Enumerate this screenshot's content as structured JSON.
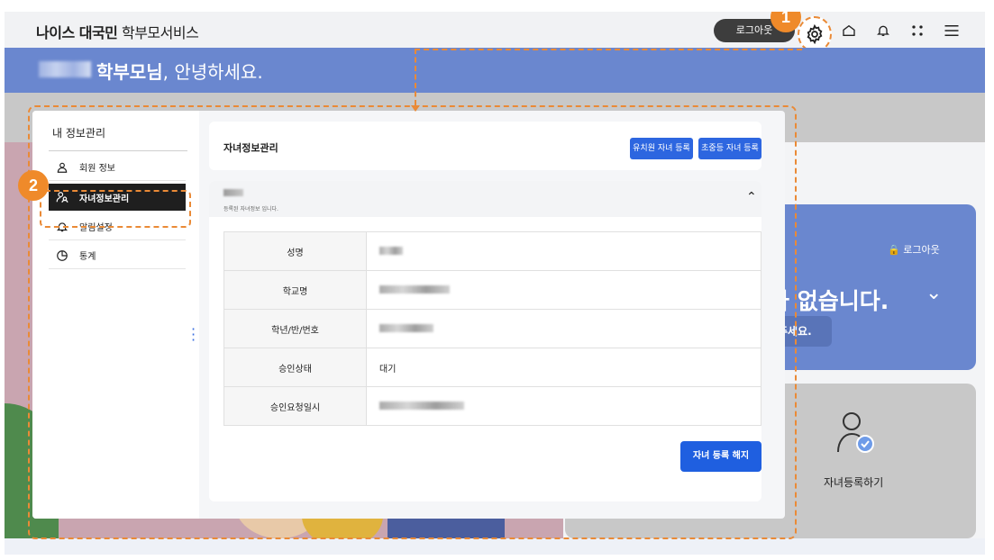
{
  "header": {
    "brand_bold": "나이스 대국민",
    "brand_rest": " 학부모서비스",
    "logout": "로그아웃",
    "icons": [
      "gear-icon",
      "home-icon",
      "bell-icon",
      "apps-icon",
      "menu-icon"
    ]
  },
  "banner": {
    "greeting_bold": "학부모님",
    "greeting_rest": ", 안녕하세요."
  },
  "background_cards": {
    "lock_label": "로그아웃",
    "big_text": "가 없습니다.",
    "button_text": "주세요.",
    "register_label": "자녀등록하기"
  },
  "sidebar": {
    "title": "내 정보관리",
    "items": [
      {
        "label": "회원 정보",
        "icon": "user-icon"
      },
      {
        "label": "자녀정보관리",
        "icon": "children-icon"
      },
      {
        "label": "알림설정",
        "icon": "bell-icon"
      },
      {
        "label": "통계",
        "icon": "pie-chart-icon"
      }
    ]
  },
  "content": {
    "title": "자녀정보관리",
    "btn_kinder": "유치원 자녀 등록",
    "btn_school": "초중등 자녀 등록",
    "child_note": "등록된 자녀정보 입니다.",
    "rows": [
      {
        "label": "성명",
        "value": ""
      },
      {
        "label": "학교명",
        "value": ""
      },
      {
        "label": "학년/반/번호",
        "value": ""
      },
      {
        "label": "승인상태",
        "value": "대기"
      },
      {
        "label": "승인요청일시",
        "value": ""
      }
    ],
    "unregister": "자녀 등록 해지"
  },
  "callouts": {
    "one": "1",
    "two": "2"
  },
  "colors": {
    "accent": "#ea8a36",
    "primary": "#2d66e0",
    "banner": "#6a87cf"
  }
}
